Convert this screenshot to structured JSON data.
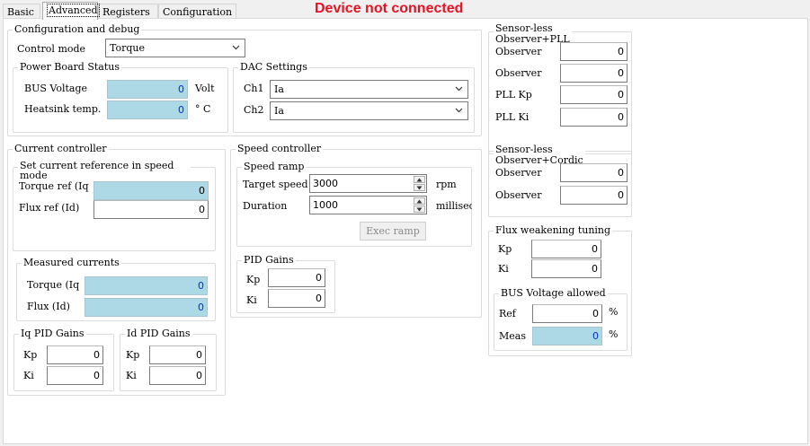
{
  "tabs": [
    "Basic",
    "Advanced",
    "Registers",
    "Configuration"
  ],
  "status_text": "Device not connected",
  "config": {
    "title": "Configuration and debug",
    "control_mode_label": "Control mode",
    "control_mode_value": "Torque",
    "power_board": {
      "title": "Power Board Status",
      "bus_voltage_label": "BUS Voltage",
      "bus_voltage_value": "0",
      "bus_voltage_unit": "Volt",
      "heatsink_label": "Heatsink temp.",
      "heatsink_value": "0",
      "heatsink_unit": "° C"
    },
    "dac": {
      "title": "DAC Settings",
      "ch1_label": "Ch1",
      "ch1_value": "Ia",
      "ch2_label": "Ch2",
      "ch2_value": "Ia"
    }
  },
  "observer_pll": {
    "title_line1": "Sensor-less",
    "title_line2": "Observer+PLL",
    "rows": [
      {
        "label": "Observer",
        "value": "0"
      },
      {
        "label": "Observer",
        "value": "0"
      },
      {
        "label": "PLL Kp",
        "value": "0"
      },
      {
        "label": "PLL Ki",
        "value": "0"
      }
    ]
  },
  "current_controller": {
    "title": "Current controller",
    "set_ref": {
      "title": "Set current reference in speed mode",
      "torque_label": "Torque ref (Iq",
      "torque_value": "0",
      "flux_label": "Flux ref (Id)",
      "flux_value": "0"
    },
    "measured": {
      "title": "Measured currents",
      "torque_label": "Torque (Iq",
      "torque_value": "0",
      "flux_label": "Flux (Id)",
      "flux_value": "0"
    },
    "iq_pid": {
      "title": "Iq PID Gains",
      "kp_label": "Kp",
      "kp_value": "0",
      "ki_label": "Ki",
      "ki_value": "0"
    },
    "id_pid": {
      "title": "Id PID Gains",
      "kp_label": "Kp",
      "kp_value": "0",
      "ki_label": "Ki",
      "ki_value": "0"
    }
  },
  "speed_controller": {
    "title": "Speed controller",
    "ramp": {
      "title": "Speed ramp",
      "target_label": "Target speed",
      "target_value": "3000",
      "target_unit": "rpm",
      "duration_label": "Duration",
      "duration_value": "1000",
      "duration_unit": "millisec",
      "exec_label": "Exec ramp"
    },
    "pid": {
      "title": "PID Gains",
      "kp_label": "Kp",
      "kp_value": "0",
      "ki_label": "Ki",
      "ki_value": "0"
    }
  },
  "observer_cordic": {
    "title_line1": "Sensor-less",
    "title_line2": "Observer+Cordic",
    "rows": [
      {
        "label": "Observer",
        "value": "0"
      },
      {
        "label": "Observer",
        "value": "0"
      }
    ]
  },
  "flux_weakening": {
    "title": "Flux weakening tuning",
    "kp_label": "Kp",
    "kp_value": "0",
    "ki_label": "Ki",
    "ki_value": "0",
    "bus": {
      "title": "BUS Voltage allowed",
      "ref_label": "Ref",
      "ref_value": "0",
      "ref_unit": "%",
      "meas_label": "Meas",
      "meas_value": "0",
      "meas_unit": "%"
    }
  }
}
